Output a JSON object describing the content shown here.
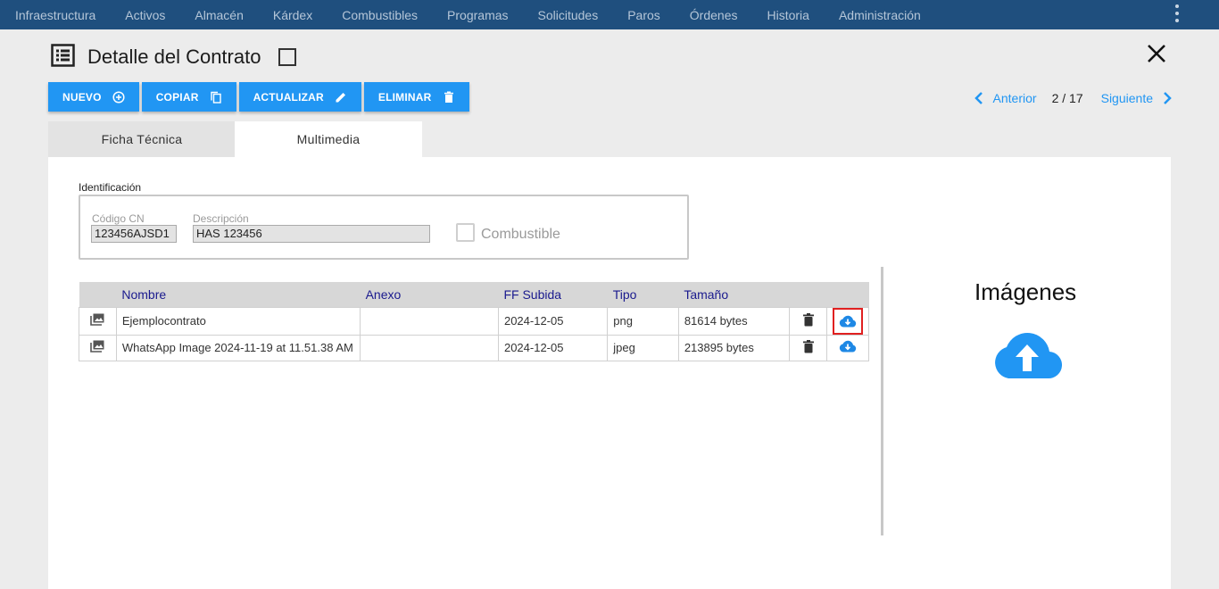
{
  "nav": {
    "items": [
      "Infraestructura",
      "Activos",
      "Almacén",
      "Kárdex",
      "Combustibles",
      "Programas",
      "Solicitudes",
      "Paros",
      "Órdenes",
      "Historia",
      "Administración"
    ]
  },
  "header": {
    "title": "Detalle del Contrato"
  },
  "toolbar": {
    "nuevo": "NUEVO",
    "copiar": "COPIAR",
    "actualizar": "ACTUALIZAR",
    "eliminar": "ELIMINAR"
  },
  "pager": {
    "prev": "Anterior",
    "count": "2 / 17",
    "next": "Siguiente"
  },
  "tabs": {
    "ficha": "Ficha Técnica",
    "multimedia": "Multimedia"
  },
  "identificacion": {
    "label": "Identificación",
    "codigo_label": "Código CN",
    "codigo_value": "123456AJSD1",
    "descripcion_label": "Descripción",
    "descripcion_value": "HAS 123456",
    "combustible_label": "Combustible"
  },
  "table": {
    "headers": {
      "nombre": "Nombre",
      "anexo": "Anexo",
      "subida": "FF Subida",
      "tipo": "Tipo",
      "tamano": "Tamaño"
    },
    "rows": [
      {
        "nombre": "Ejemplocontrato",
        "anexo": "",
        "subida": "2024-12-05",
        "tipo": "png",
        "tamano": "81614 bytes"
      },
      {
        "nombre": "WhatsApp Image 2024-11-19 at 11.51.38 AM",
        "anexo": "",
        "subida": "2024-12-05",
        "tipo": "jpeg",
        "tamano": "213895 bytes"
      }
    ]
  },
  "images": {
    "title": "Imágenes"
  },
  "colors": {
    "nav_bg": "#1f4f7e",
    "accent": "#2196f3",
    "header_text": "#1a1a8e",
    "highlight": "#e02020"
  }
}
